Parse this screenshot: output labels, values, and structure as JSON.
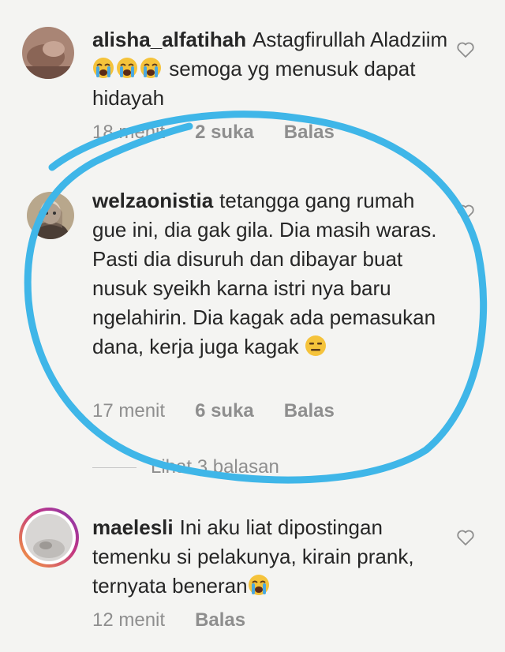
{
  "comments": [
    {
      "username": "alisha_alfatihah",
      "text_before_emoji": "Astagfirullah Aladziim",
      "emoji": [
        "loudly-crying-face",
        "loudly-crying-face",
        "loudly-crying-face"
      ],
      "text_after_emoji": "semoga yg menusuk dapat hidayah",
      "time": "18 menit",
      "likes": "2 suka",
      "reply": "Balas"
    },
    {
      "username": "welzaonistia",
      "text_before_emoji": "tetangga gang rumah gue ini, dia gak gila. Dia masih waras. Pasti dia disuruh dan dibayar buat nusuk syeikh karna istri nya baru ngelahirin. Dia kagak ada pemasukan dana, kerja juga kagak",
      "emoji": [
        "expressionless-face"
      ],
      "time": "17 menit",
      "likes": "6 suka",
      "reply": "Balas",
      "view_replies": "Lihat 3 balasan"
    },
    {
      "username": "maelesli",
      "text_before_emoji": "Ini aku liat dipostingan temenku si pelakunya, kirain prank, ternyata beneran",
      "emoji": [
        "loudly-crying-face"
      ],
      "time": "12 menit",
      "reply": "Balas"
    }
  ],
  "colors": {
    "annotation_circle": "#3fb6e8",
    "meta_text": "#8e8e8e",
    "story_ring": "#c13584"
  }
}
